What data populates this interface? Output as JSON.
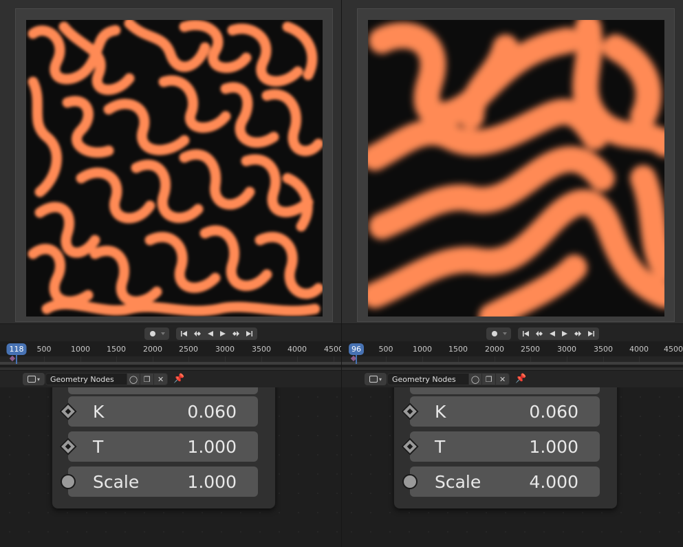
{
  "colors": {
    "pattern_orange": "#ff8a55",
    "pattern_black": "#0c0c0c",
    "frame_accent": "#4772b3",
    "keyframe": "#8a5a8a"
  },
  "playback": {
    "record_icon": "record-dot-icon",
    "buttons": [
      "jump-to-start-icon",
      "prev-keyframe-icon",
      "play-reverse-icon",
      "play-icon",
      "next-keyframe-icon",
      "jump-to-end-icon"
    ]
  },
  "timeline": {
    "tick_labels": [
      "500",
      "1000",
      "1500",
      "2000",
      "2500",
      "3000",
      "3500",
      "4000",
      "4500"
    ]
  },
  "panels": [
    {
      "current_frame": "118",
      "editor_name": "Geometry Nodes",
      "params": [
        {
          "label": "K",
          "value": "0.060",
          "socket": "diamond"
        },
        {
          "label": "T",
          "value": "1.000",
          "socket": "diamond"
        },
        {
          "label": "Scale",
          "value": "1.000",
          "socket": "circle"
        }
      ]
    },
    {
      "current_frame": "96",
      "editor_name": "Geometry Nodes",
      "params": [
        {
          "label": "K",
          "value": "0.060",
          "socket": "diamond"
        },
        {
          "label": "T",
          "value": "1.000",
          "socket": "diamond"
        },
        {
          "label": "Scale",
          "value": "4.000",
          "socket": "circle"
        }
      ]
    }
  ]
}
